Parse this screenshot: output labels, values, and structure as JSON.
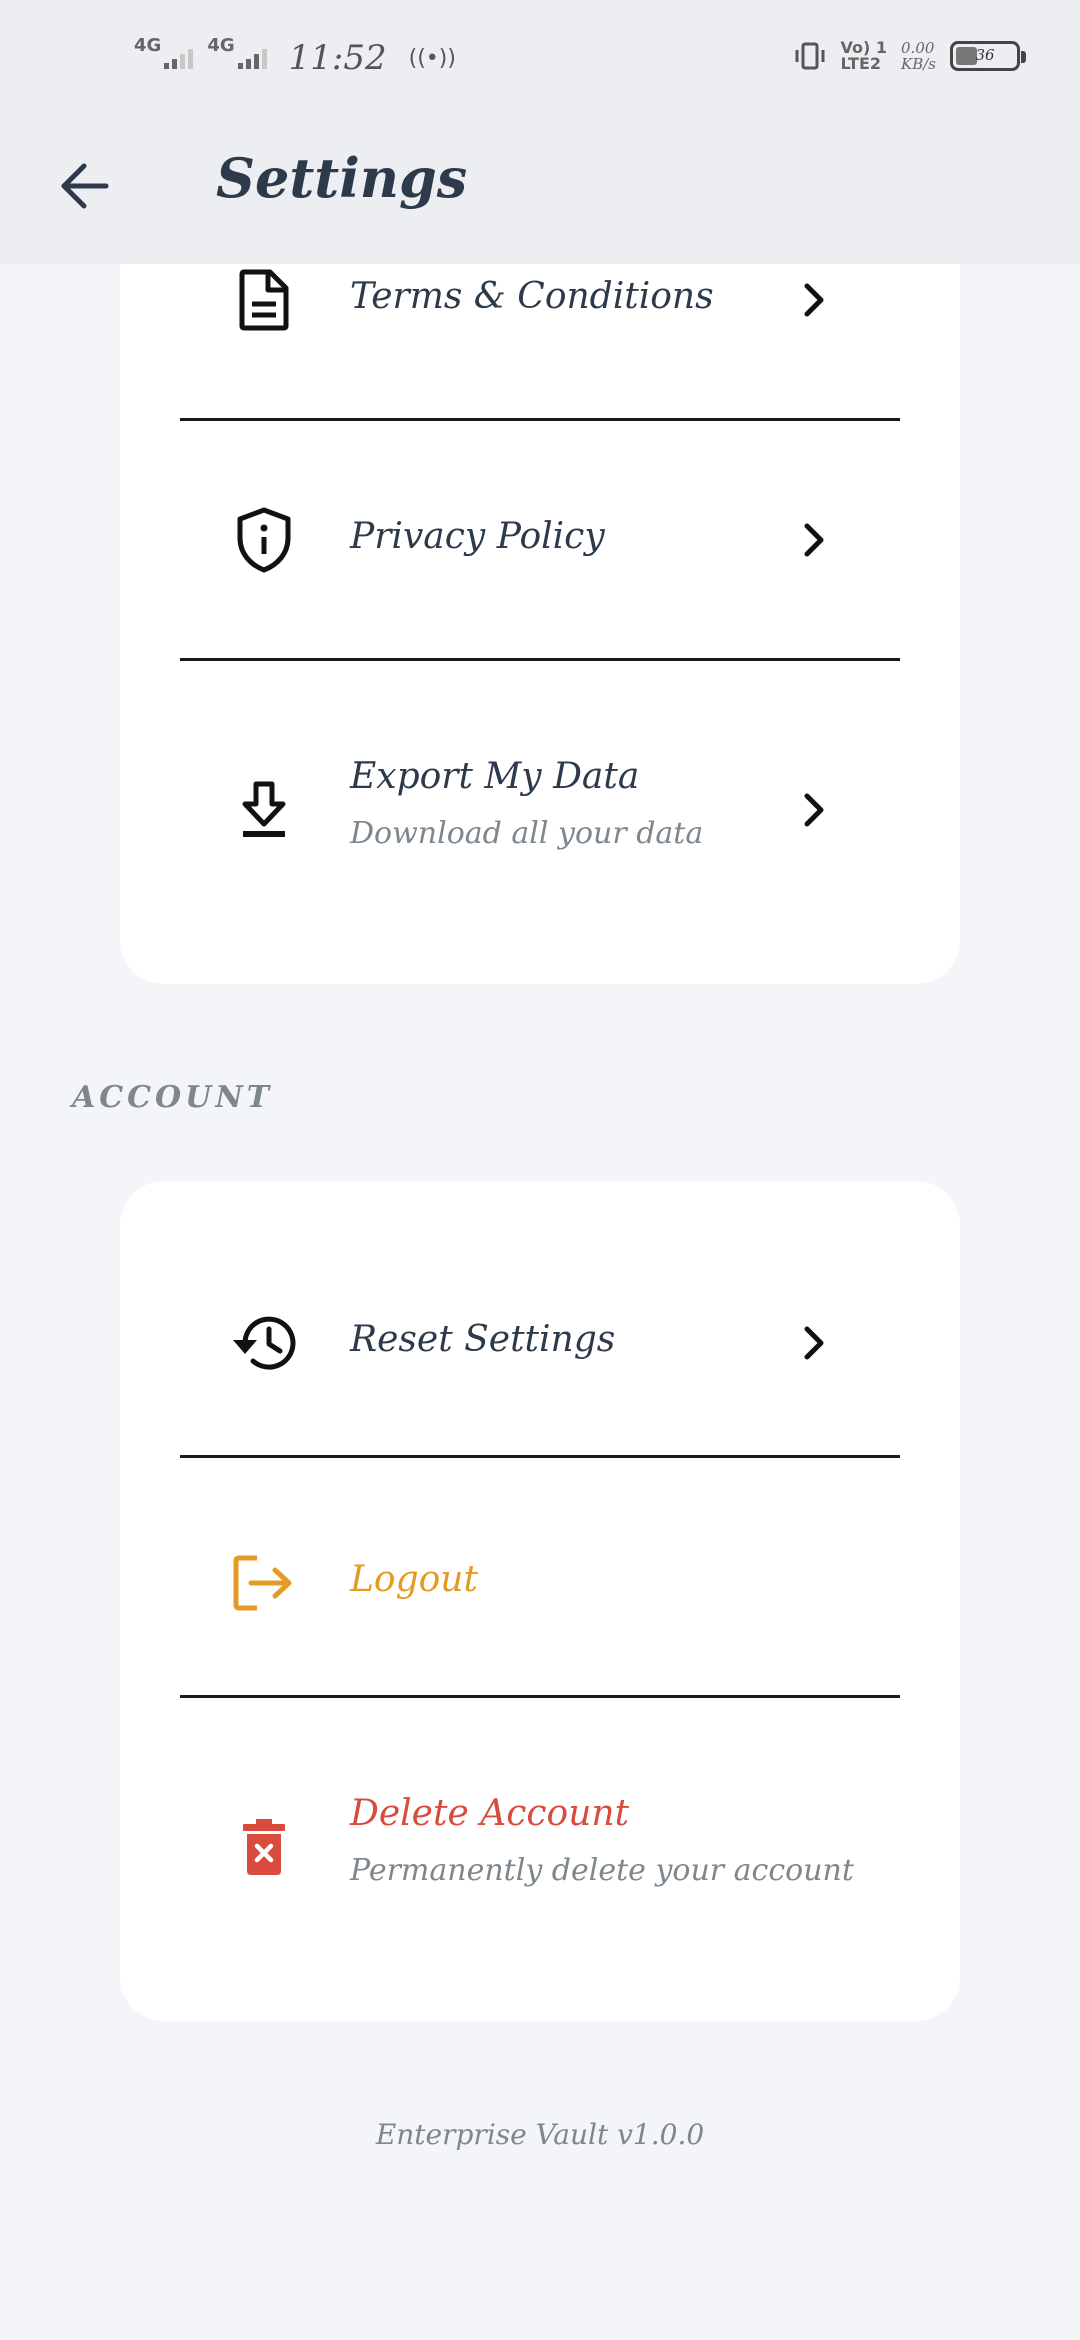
{
  "status_bar": {
    "network1": "4G",
    "network2": "4G",
    "time": "11:52",
    "volte_line1": "Vo) 1",
    "volte_line2": "LTE2",
    "speed_value": "0.00",
    "speed_unit": "KB/s",
    "battery_level": "36"
  },
  "app_bar": {
    "title": "Settings"
  },
  "legal_section": {
    "items": [
      {
        "title": "Terms & Conditions",
        "icon": "document-icon"
      },
      {
        "title": "Privacy Policy",
        "icon": "shield-info-icon"
      },
      {
        "title": "Export My Data",
        "subtitle": "Download all your data",
        "icon": "download-icon"
      }
    ]
  },
  "account_section": {
    "label": "ACCOUNT",
    "items": [
      {
        "title": "Reset Settings",
        "icon": "history-icon"
      },
      {
        "title": "Logout",
        "icon": "logout-icon",
        "color": "#e39b24"
      },
      {
        "title": "Delete Account",
        "subtitle": "Permanently delete your account",
        "icon": "trash-icon",
        "color": "#d94b3d"
      }
    ]
  },
  "footer": {
    "version": "Enterprise Vault v1.0.0"
  },
  "colors": {
    "background": "#f3f5f9",
    "card": "#ffffff",
    "title_text": "#2c3a4b",
    "muted_text": "#7d878d",
    "logout": "#e39b24",
    "delete": "#d94b3d"
  }
}
